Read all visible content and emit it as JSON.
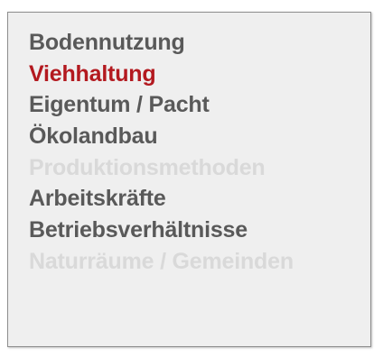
{
  "menu": {
    "items": [
      {
        "label": "Bodennutzung",
        "state": "normal"
      },
      {
        "label": "Viehhaltung",
        "state": "active"
      },
      {
        "label": "Eigentum / Pacht",
        "state": "normal"
      },
      {
        "label": "Ökolandbau",
        "state": "normal"
      },
      {
        "label": "Produktionsmethoden",
        "state": "disabled"
      },
      {
        "label": "Arbeitskräfte",
        "state": "normal"
      },
      {
        "label": "Betriebsverhältnisse",
        "state": "normal"
      },
      {
        "label": "Naturräume / Gemeinden",
        "state": "disabled"
      }
    ]
  },
  "colors": {
    "normal_text": "#595959",
    "active_text": "#b3191f",
    "disabled_text": "#d9d9d9",
    "panel_background": "#efefef",
    "panel_border": "#8e8e8e"
  }
}
